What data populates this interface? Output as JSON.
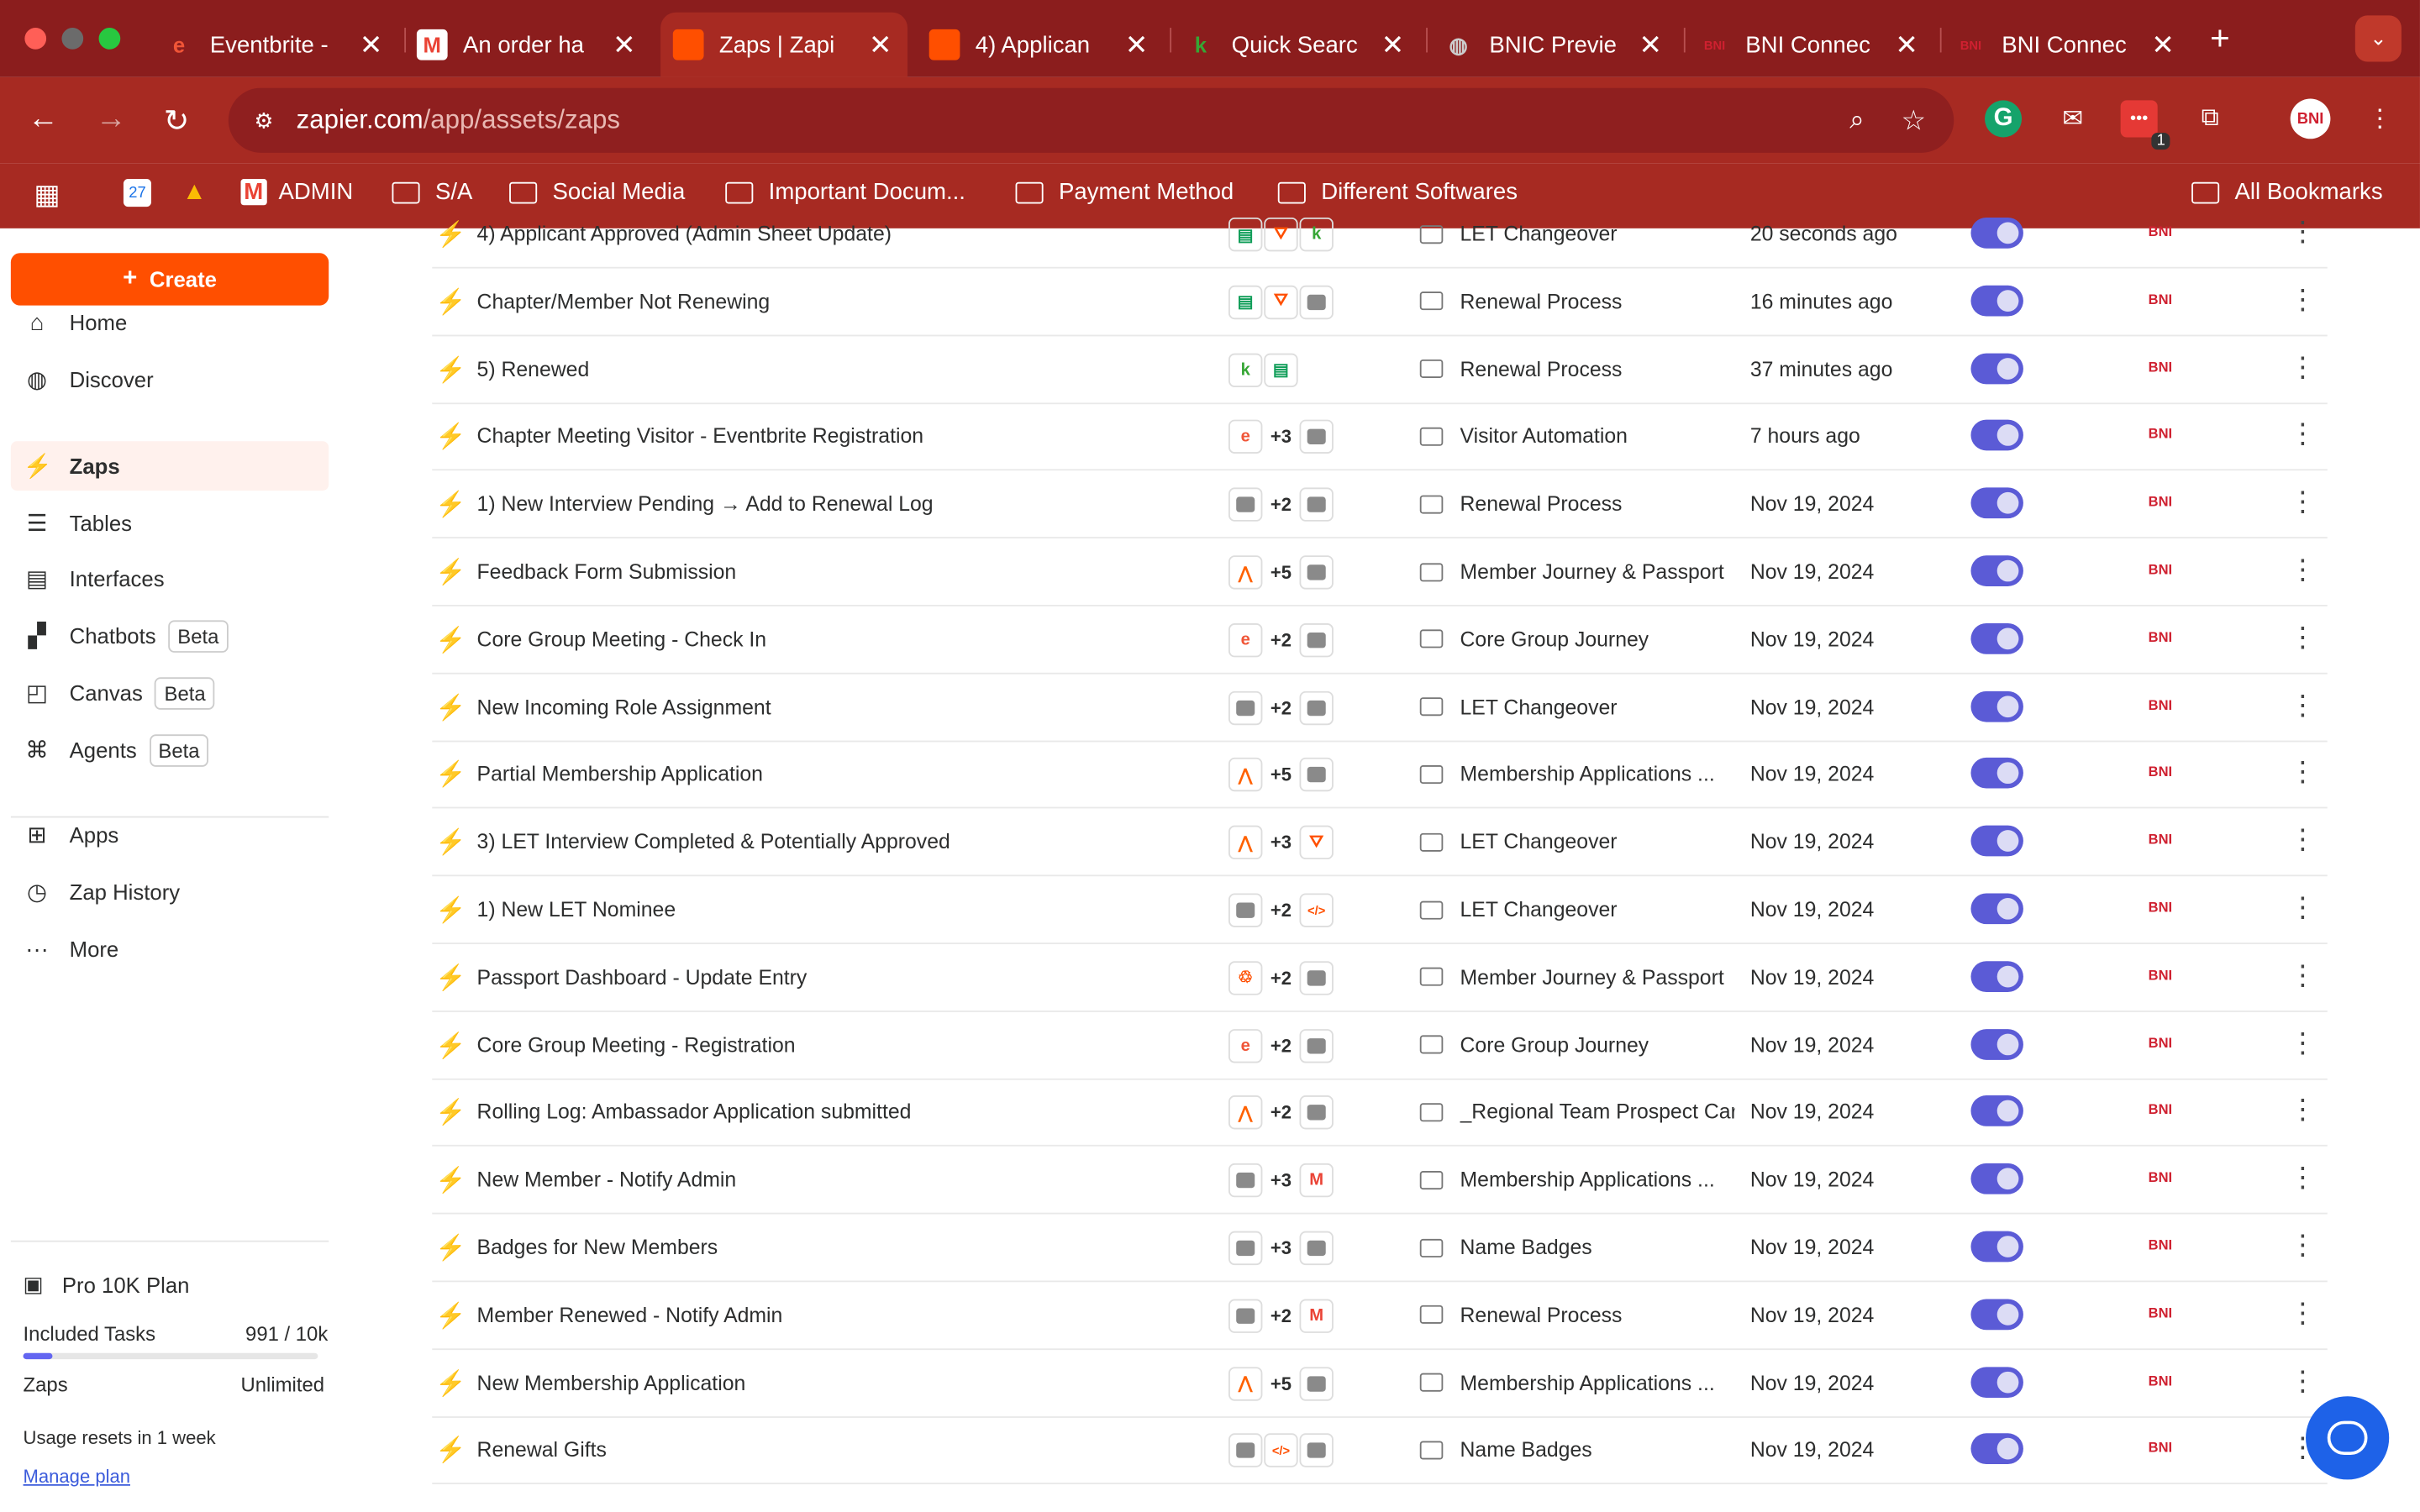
{
  "browser": {
    "tabs": [
      {
        "label": "Eventbrite -",
        "icon": "eventbrite-icon",
        "glyph": "e",
        "color": "#f05537",
        "close": "✕"
      },
      {
        "label": "An order ha",
        "icon": "gmail-icon",
        "glyph": "M",
        "color": "#ea4335",
        "close": "✕"
      },
      {
        "label": "Zaps | Zapi",
        "icon": "zapier-icon",
        "glyph": "",
        "color": "#ff4f00",
        "close": "✕"
      },
      {
        "label": "4) Applican",
        "icon": "zapier-icon",
        "glyph": "",
        "color": "#ff4f00",
        "close": "✕"
      },
      {
        "label": "Quick Searc",
        "icon": "keap-icon",
        "glyph": "k",
        "color": "#36a635",
        "close": "✕"
      },
      {
        "label": "BNIC Previe",
        "icon": "globe-icon",
        "glyph": "◍",
        "color": "#cccccc",
        "close": "✕"
      },
      {
        "label": "BNI Connec",
        "icon": "bni-icon",
        "glyph": "BNI",
        "color": "#cf2030",
        "close": "✕"
      },
      {
        "label": "BNI Connec",
        "icon": "bni-icon",
        "glyph": "BNI",
        "color": "#cf2030",
        "close": "✕"
      }
    ],
    "new_tab": "+",
    "url_host": "zapier.com",
    "url_path": "/app/assets/zaps",
    "profile": "BNI",
    "ext_badge": "1",
    "bookmarks": [
      {
        "label": "ADMIN",
        "type": "gmail"
      },
      {
        "label": "S/A",
        "type": "folder"
      },
      {
        "label": "Social Media",
        "type": "folder"
      },
      {
        "label": "Important Docum...",
        "type": "folder"
      },
      {
        "label": "Payment Method",
        "type": "folder"
      },
      {
        "label": "Different Softwares",
        "type": "folder"
      }
    ],
    "all_bookmarks": "All Bookmarks",
    "calendar_date": "27"
  },
  "sidebar": {
    "create": "Create",
    "items": [
      {
        "label": "Home",
        "icon": "home-icon"
      },
      {
        "label": "Discover",
        "icon": "globe-icon"
      },
      {
        "label": "Zaps",
        "icon": "zap-icon",
        "active": true
      },
      {
        "label": "Tables",
        "icon": "tables-icon"
      },
      {
        "label": "Interfaces",
        "icon": "interfaces-icon"
      },
      {
        "label": "Chatbots",
        "icon": "chatbots-icon",
        "badge": "Beta"
      },
      {
        "label": "Canvas",
        "icon": "canvas-icon",
        "badge": "Beta"
      },
      {
        "label": "Agents",
        "icon": "agents-icon",
        "badge": "Beta"
      },
      {
        "label": "Apps",
        "icon": "apps-icon"
      },
      {
        "label": "Zap History",
        "icon": "history-icon"
      },
      {
        "label": "More",
        "icon": "more-icon"
      }
    ],
    "plan": {
      "name": "Pro 10K Plan",
      "tasks_label": "Included Tasks",
      "tasks_value": "991 / 10k",
      "tasks_fraction": 0.0991,
      "zaps_label": "Zaps",
      "zaps_value": "Unlimited",
      "reset_note": "Usage resets in 1 week",
      "manage": "Manage plan"
    }
  },
  "zaps": [
    {
      "name": "4) Applicant Approved (Admin Sheet Update)",
      "apps": [
        "sheets",
        "filter",
        "keap"
      ],
      "folder": "LET Changeover",
      "edited": "20 seconds ago"
    },
    {
      "name": "Chapter/Member Not Renewing",
      "apps": [
        "sheets",
        "filter",
        "gray"
      ],
      "folder": "Renewal Process",
      "edited": "16 minutes ago"
    },
    {
      "name": "5) Renewed",
      "apps": [
        "keap",
        "sheets"
      ],
      "folder": "Renewal Process",
      "edited": "37 minutes ago"
    },
    {
      "name": "Chapter Meeting Visitor - Eventbrite Registration",
      "apps": [
        "eventbrite",
        "+3",
        "gray"
      ],
      "folder": "Visitor Automation",
      "edited": "7 hours ago"
    },
    {
      "name": "1) New Interview Pending → Add to Renewal Log",
      "apps": [
        "gray",
        "+2",
        "gray"
      ],
      "folder": "Renewal Process",
      "edited": "Nov 19, 2024"
    },
    {
      "name": "Feedback Form Submission",
      "apps": [
        "jotform",
        "+5",
        "gray"
      ],
      "folder": "Member Journey & Passport",
      "edited": "Nov 19, 2024"
    },
    {
      "name": "Core Group Meeting - Check In",
      "apps": [
        "eventbrite",
        "+2",
        "gray"
      ],
      "folder": "Core Group Journey",
      "edited": "Nov 19, 2024"
    },
    {
      "name": "New Incoming Role Assignment",
      "apps": [
        "gray",
        "+2",
        "gray"
      ],
      "folder": "LET Changeover",
      "edited": "Nov 19, 2024"
    },
    {
      "name": "Partial Membership Application",
      "apps": [
        "jotform",
        "+5",
        "gray"
      ],
      "folder": "Membership Applications ...",
      "edited": "Nov 19, 2024"
    },
    {
      "name": "3) LET Interview Completed & Potentially Approved",
      "apps": [
        "jotform",
        "+3",
        "filter"
      ],
      "folder": "LET Changeover",
      "edited": "Nov 19, 2024"
    },
    {
      "name": "1) New LET Nominee",
      "apps": [
        "gray",
        "+2",
        "code"
      ],
      "folder": "LET Changeover",
      "edited": "Nov 19, 2024"
    },
    {
      "name": "Passport Dashboard - Update Entry",
      "apps": [
        "webhook",
        "+2",
        "gray"
      ],
      "folder": "Member Journey & Passport",
      "edited": "Nov 19, 2024"
    },
    {
      "name": "Core Group Meeting - Registration",
      "apps": [
        "eventbrite",
        "+2",
        "gray"
      ],
      "folder": "Core Group Journey",
      "edited": "Nov 19, 2024"
    },
    {
      "name": "Rolling Log: Ambassador Application submitted",
      "apps": [
        "jotform",
        "+2",
        "gray"
      ],
      "folder": "_Regional Team Prospect Car",
      "edited": "Nov 19, 2024"
    },
    {
      "name": "New Member - Notify Admin",
      "apps": [
        "gray",
        "+3",
        "gmail"
      ],
      "folder": "Membership Applications ...",
      "edited": "Nov 19, 2024"
    },
    {
      "name": "Badges for New Members",
      "apps": [
        "gray",
        "+3",
        "gray"
      ],
      "folder": "Name Badges",
      "edited": "Nov 19, 2024"
    },
    {
      "name": "Member Renewed - Notify Admin",
      "apps": [
        "gray",
        "+2",
        "gmail"
      ],
      "folder": "Renewal Process",
      "edited": "Nov 19, 2024"
    },
    {
      "name": "New Membership Application",
      "apps": [
        "jotform",
        "+5",
        "gray"
      ],
      "folder": "Membership Applications ...",
      "edited": "Nov 19, 2024"
    },
    {
      "name": "Renewal Gifts",
      "apps": [
        "gray",
        "code",
        "gray"
      ],
      "folder": "Name Badges",
      "edited": "Nov 19, 2024"
    }
  ],
  "owner_label": "BNI",
  "colors": {
    "brand": "#ff4f00",
    "toggle": "#5b5bd6",
    "chrome": "#a72a22"
  }
}
